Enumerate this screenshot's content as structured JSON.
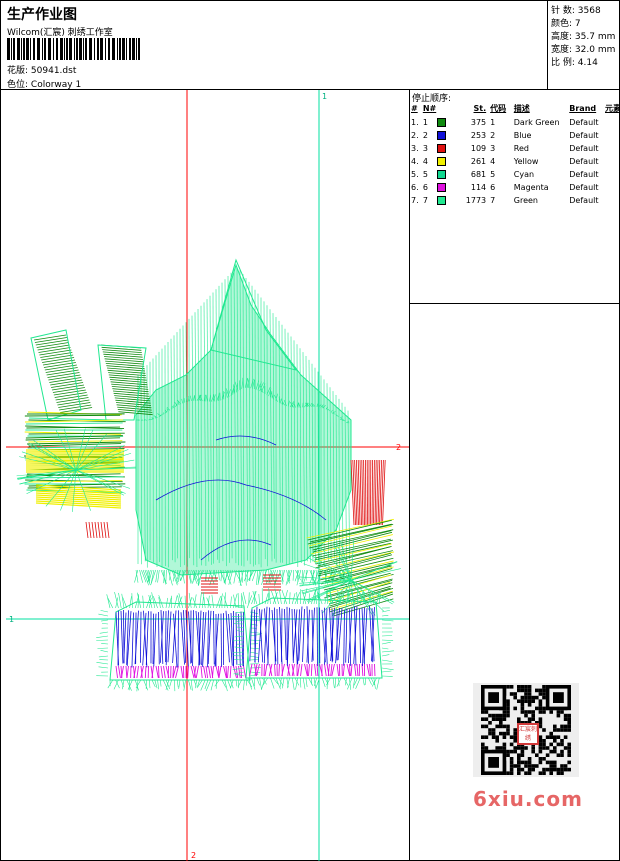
{
  "header": {
    "title": "生产作业图",
    "studio": "Wilcom(汇宸) 刺绣工作室",
    "design_label": "花版:",
    "design_value": "50941.dst",
    "colorway_label": "色位:",
    "colorway_value": "Colorway 1"
  },
  "stats": [
    {
      "label": "针 数:",
      "value": "3568"
    },
    {
      "label": "颜色:",
      "value": "7"
    },
    {
      "label": "高度:",
      "value": "35.7 mm"
    },
    {
      "label": "宽度:",
      "value": "32.0 mm"
    },
    {
      "label": "比 例:",
      "value": "4.14"
    }
  ],
  "guides": {
    "h1_label": "1",
    "h2_label": "2",
    "v1_label": "1",
    "v2_label": "2",
    "red": "#ff0000",
    "cyan": "#00e0a0"
  },
  "stop_sequence": {
    "title": "停止顺序:",
    "headers": [
      "#",
      "N#",
      "St.",
      "代码",
      "描述",
      "Brand",
      "元素"
    ],
    "rows": [
      {
        "idx": "1.",
        "n": "1",
        "color": "#0f8a0f",
        "st": "375",
        "code": "1",
        "desc": "Dark Green",
        "brand": "Default"
      },
      {
        "idx": "2.",
        "n": "2",
        "color": "#1010d8",
        "st": "253",
        "code": "2",
        "desc": "Blue",
        "brand": "Default"
      },
      {
        "idx": "3.",
        "n": "3",
        "color": "#e01010",
        "st": "109",
        "code": "3",
        "desc": "Red",
        "brand": "Default"
      },
      {
        "idx": "4.",
        "n": "4",
        "color": "#f0f000",
        "st": "261",
        "code": "4",
        "desc": "Yellow",
        "brand": "Default"
      },
      {
        "idx": "5.",
        "n": "5",
        "color": "#10d890",
        "st": "681",
        "code": "5",
        "desc": "Cyan",
        "brand": "Default"
      },
      {
        "idx": "6.",
        "n": "6",
        "color": "#e010e0",
        "st": "114",
        "code": "6",
        "desc": "Magenta",
        "brand": "Default"
      },
      {
        "idx": "7.",
        "n": "7",
        "color": "#20e890",
        "st": "1773",
        "code": "7",
        "desc": "Green",
        "brand": "Default"
      }
    ]
  },
  "seal_text": "汇宸刺绣",
  "watermark": "6xiu.com"
}
